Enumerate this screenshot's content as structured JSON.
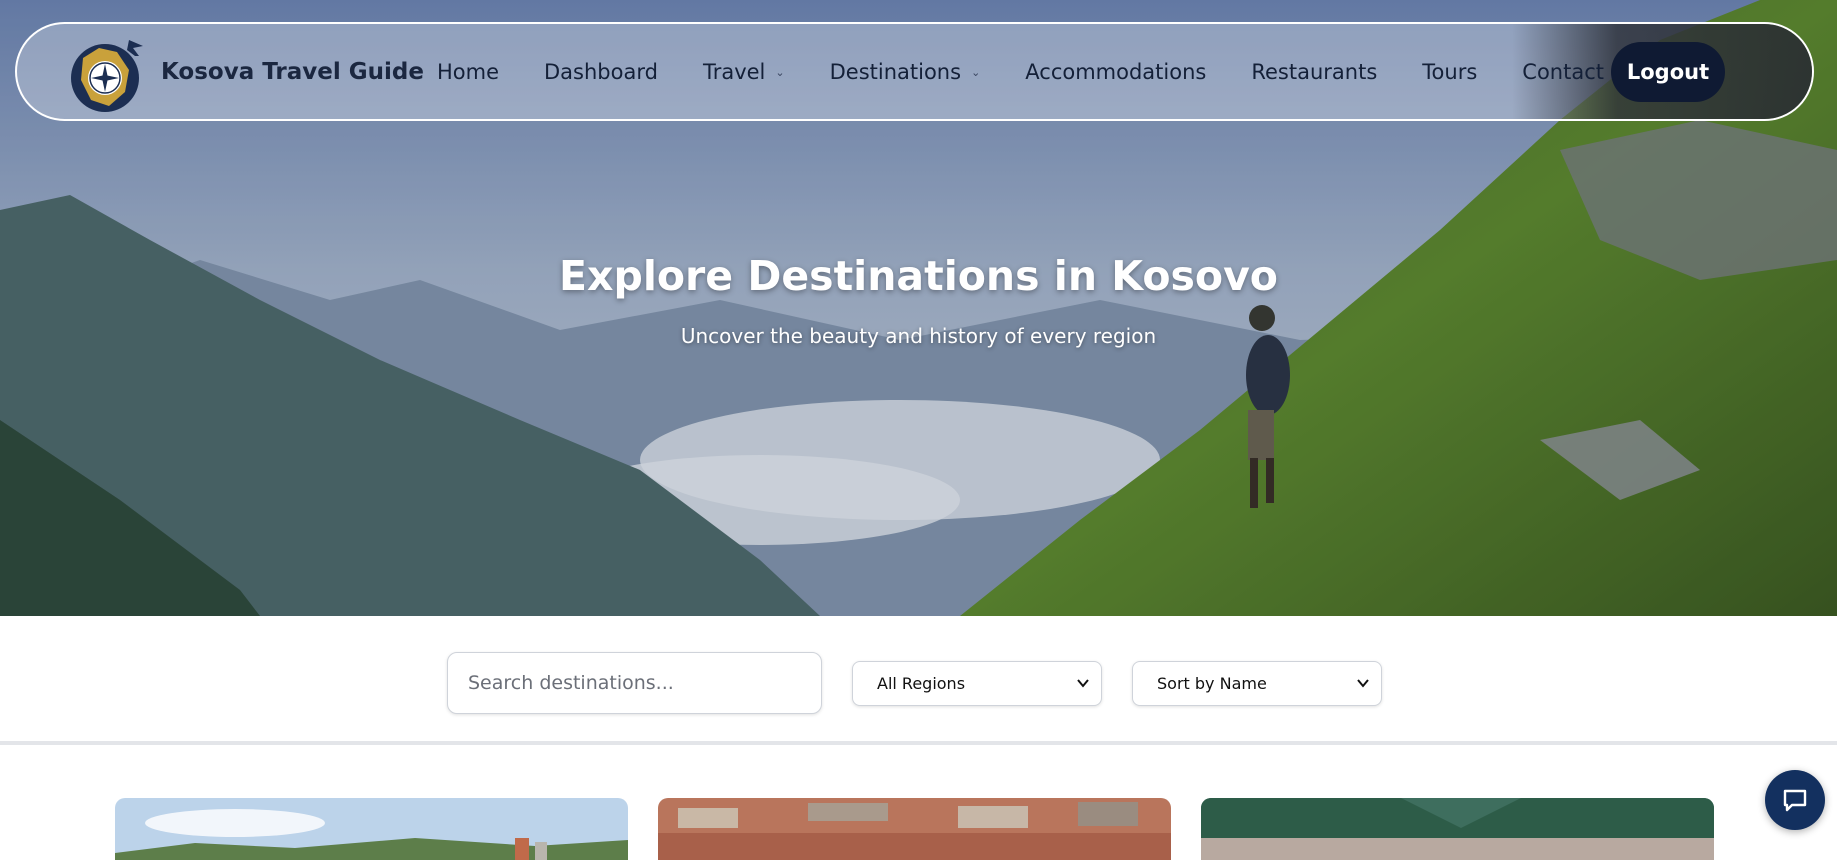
{
  "nav": {
    "brand": "Kosova Travel Guide",
    "items": [
      {
        "label": "Home",
        "dropdown": false
      },
      {
        "label": "Dashboard",
        "dropdown": false
      },
      {
        "label": "Travel",
        "dropdown": true
      },
      {
        "label": "Destinations",
        "dropdown": true
      },
      {
        "label": "Accommodations",
        "dropdown": false
      },
      {
        "label": "Restaurants",
        "dropdown": false
      },
      {
        "label": "Tours",
        "dropdown": false
      },
      {
        "label": "Contact",
        "dropdown": false
      }
    ],
    "logout_label": "Logout"
  },
  "hero": {
    "title": "Explore Destinations in Kosovo",
    "subtitle": "Uncover the beauty and history of every region"
  },
  "filters": {
    "search_placeholder": "Search destinations...",
    "region_selected": "All Regions",
    "sort_selected": "Sort by Name"
  },
  "icons": {
    "logo": "compass-logo-icon",
    "chat": "chat-icon",
    "dropdown": "chevron-down-icon"
  },
  "colors": {
    "primary_dark": "#0f1a33",
    "chat_button": "#13305f",
    "logo_gold": "#c9a13b"
  }
}
